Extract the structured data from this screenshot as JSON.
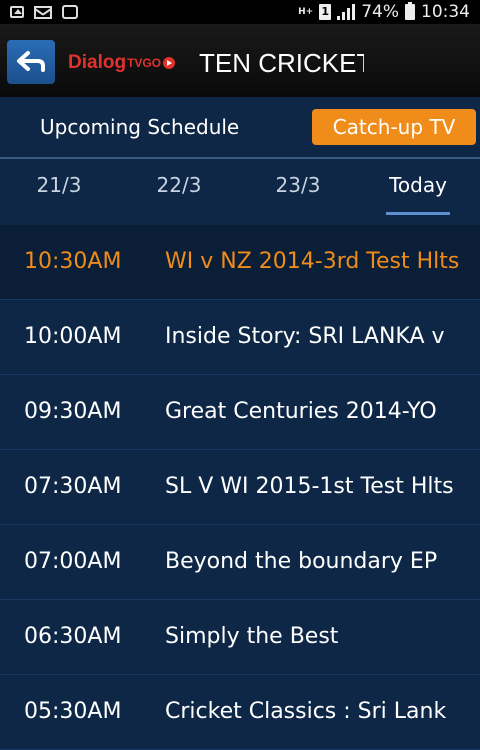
{
  "status_bar": {
    "battery": "74%",
    "time": "10:34",
    "network": "H+",
    "sim": "1"
  },
  "app_bar": {
    "logo_brand": "Dialog",
    "logo_suffix": "TVGO",
    "channel_title": "TEN CRICKET"
  },
  "mode_tabs": {
    "upcoming": "Upcoming Schedule",
    "catchup": "Catch-up TV",
    "active": "Catch-up TV"
  },
  "date_tabs": [
    "21/3",
    "22/3",
    "23/3",
    "Today"
  ],
  "active_date": "Today",
  "schedule": [
    {
      "time": "10:30AM",
      "title": "WI v NZ 2014-3rd Test Hlts"
    },
    {
      "time": "10:00AM",
      "title": "Inside Story: SRI LANKA v"
    },
    {
      "time": "09:30AM",
      "title": "Great Centuries 2014-YO"
    },
    {
      "time": "07:30AM",
      "title": "SL V WI 2015-1st Test Hlts"
    },
    {
      "time": "07:00AM",
      "title": "Beyond the boundary EP"
    },
    {
      "time": "06:30AM",
      "title": "Simply the  Best"
    },
    {
      "time": "05:30AM",
      "title": "Cricket Classics : Sri Lank"
    }
  ],
  "colors": {
    "accent": "#f08c1a",
    "background": "#0e2746",
    "brand_red": "#e1322c",
    "back_button": "#2a6db5"
  }
}
